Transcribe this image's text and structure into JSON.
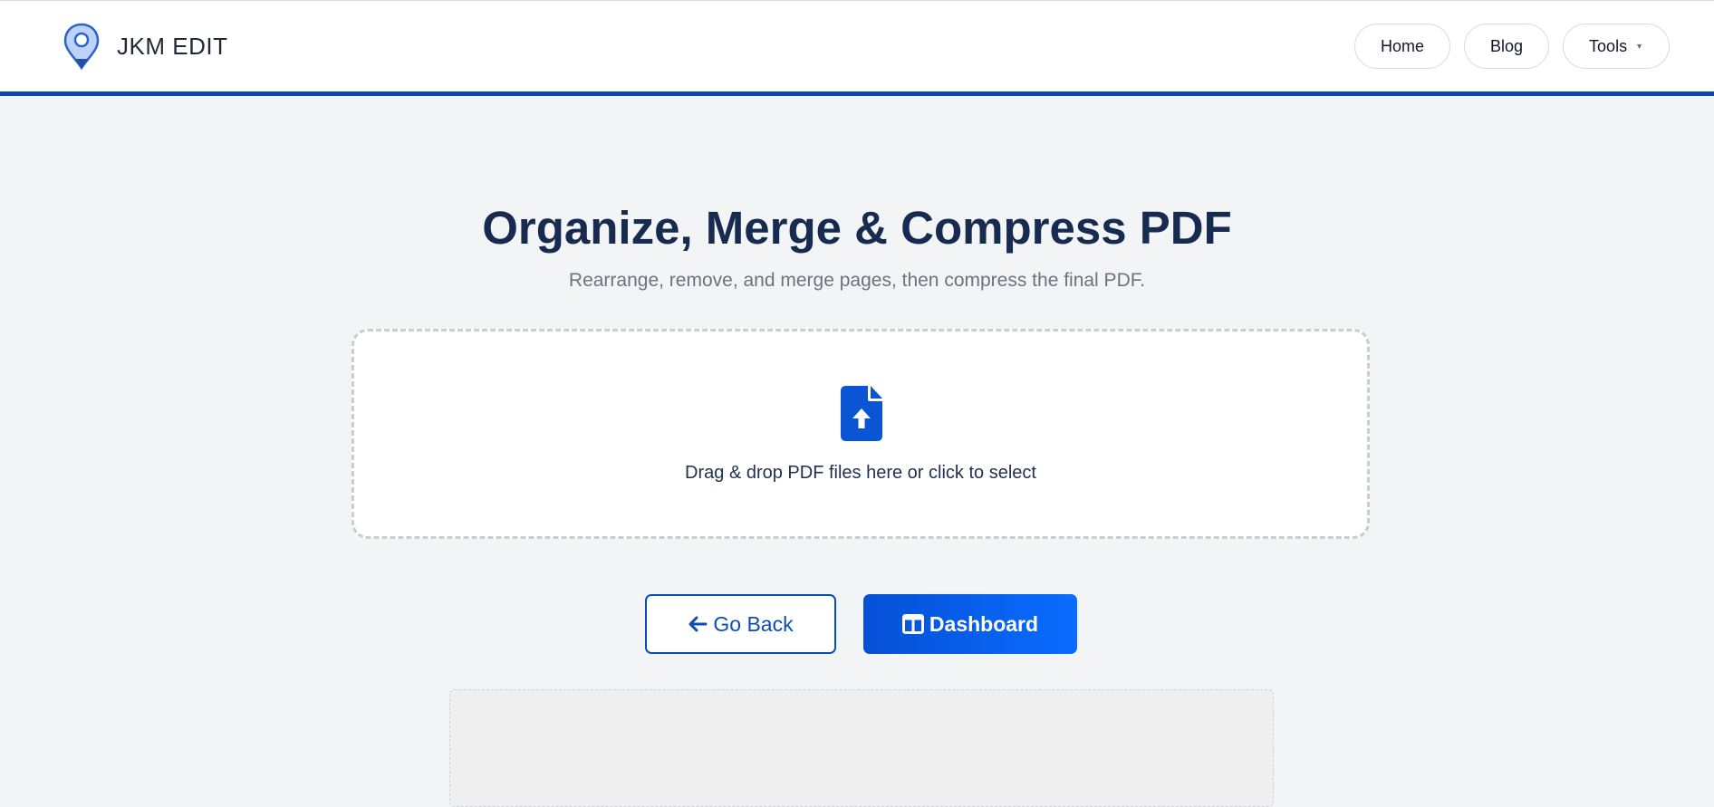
{
  "colors": {
    "brand_blue": "#0b47a8",
    "accent_blue": "#0a5ce0",
    "title_navy": "#172a4f",
    "page_bg": "#f3f4f6"
  },
  "header": {
    "brand": "JKM EDIT",
    "logo_icon": "map-pin-icon",
    "nav": {
      "home": "Home",
      "blog": "Blog",
      "tools": "Tools"
    }
  },
  "main": {
    "title": "Organize, Merge & Compress PDF",
    "subtitle": "Rearrange, remove, and merge pages, then compress the final PDF.",
    "dropzone": {
      "icon": "file-upload-icon",
      "text": "Drag & drop PDF files here or click to select"
    },
    "actions": {
      "back_label": "Go Back",
      "back_icon": "arrow-left-icon",
      "dashboard_label": "Dashboard",
      "dashboard_icon": "columns-icon"
    }
  }
}
